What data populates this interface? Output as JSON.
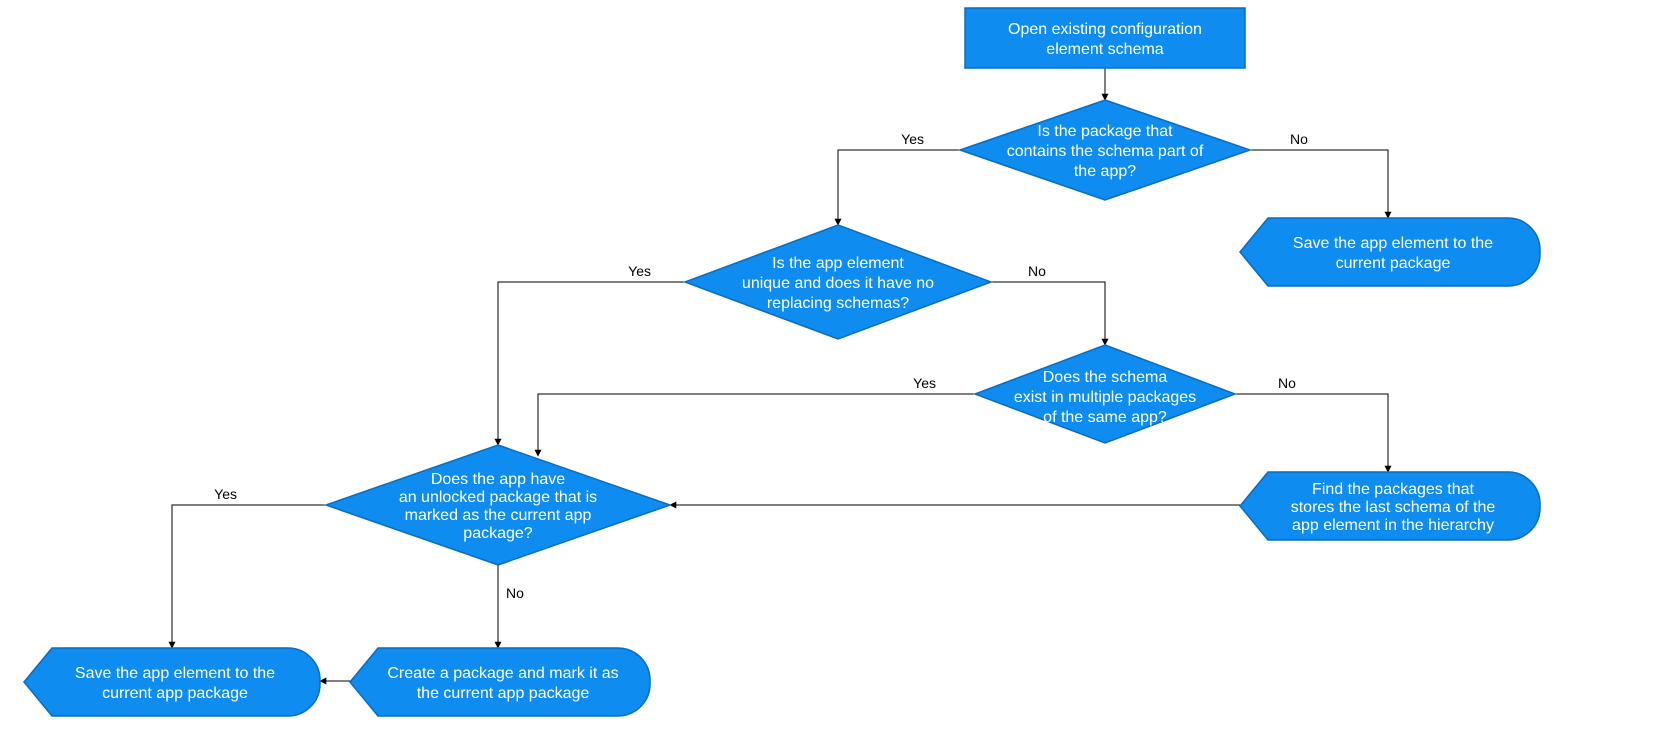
{
  "colors": {
    "node_fill": "#0E8CF0",
    "node_stroke": "#0A6CC0",
    "edge": "#000000"
  },
  "nodes": {
    "start": {
      "text": "Open existing configuration element schema"
    },
    "d1": {
      "text": "Is the package that contains the schema part of the app?"
    },
    "d2": {
      "text": "Is the app element unique and does it have no replacing schemas?"
    },
    "d3": {
      "text": "Does the schema exist in multiple packages of the same app?"
    },
    "d4": {
      "text": "Does the app have an unlocked package that is marked as the current app package?"
    },
    "p1": {
      "text": "Save the app element to the current package"
    },
    "p2": {
      "text": "Find the packages that stores the last schema of the app element in the hierarchy"
    },
    "p3": {
      "text": "Create a package and mark it as the current app package"
    },
    "p4": {
      "text": "Save the app element to the current app package"
    }
  },
  "edges": {
    "yes": "Yes",
    "no": "No"
  }
}
